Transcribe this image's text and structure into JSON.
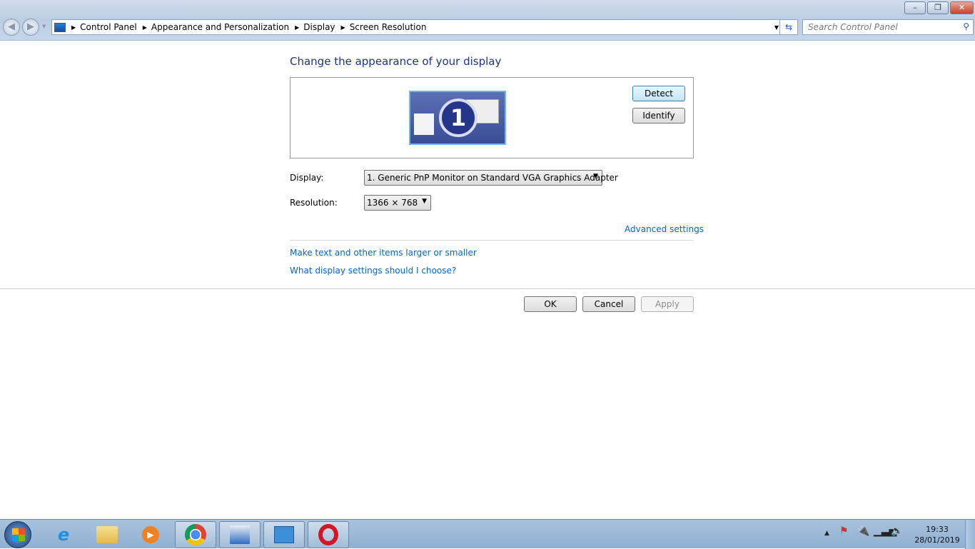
{
  "window": {
    "minimize": "–",
    "restore": "❐",
    "close": "✕"
  },
  "address": {
    "crumbs": [
      "Control Panel",
      "Appearance and Personalization",
      "Display",
      "Screen Resolution"
    ],
    "search_placeholder": "Search Control Panel"
  },
  "main": {
    "title": "Change the appearance of your display",
    "monitor_number": "1",
    "detect": "Detect",
    "identify": "Identify",
    "display_label": "Display:",
    "display_value": "1. Generic PnP Monitor on Standard VGA Graphics Adapter",
    "resolution_label": "Resolution:",
    "resolution_value": "1366 × 768",
    "advanced": "Advanced settings",
    "link_text_size": "Make text and other items larger or smaller",
    "link_help": "What display settings should I choose?",
    "ok": "OK",
    "cancel": "Cancel",
    "apply": "Apply"
  },
  "taskbar": {
    "time": "19:33",
    "date": "28/01/2019"
  }
}
